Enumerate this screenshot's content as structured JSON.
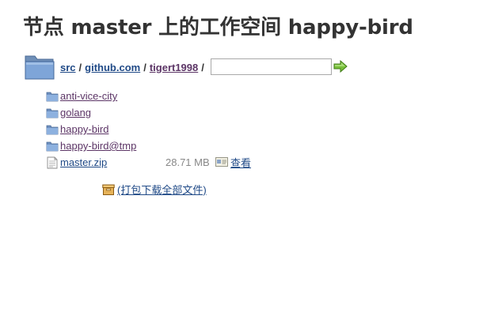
{
  "page_title": "节点 master 上的工作空间 happy-bird",
  "breadcrumb": {
    "items": [
      {
        "label": "src"
      },
      {
        "label": "github.com"
      },
      {
        "label": "tigert1998"
      }
    ],
    "separator": "/"
  },
  "path_input": {
    "value": "",
    "placeholder": ""
  },
  "entries": [
    {
      "name": "anti-vice-city",
      "type": "folder"
    },
    {
      "name": "golang",
      "type": "folder"
    },
    {
      "name": "happy-bird",
      "type": "folder"
    },
    {
      "name": "happy-bird@tmp",
      "type": "folder"
    },
    {
      "name": "master.zip",
      "type": "file",
      "size": "28.71 MB",
      "view_label": "查看"
    }
  ],
  "download_all": {
    "label": "(打包下载全部文件)"
  },
  "colors": {
    "link": "#204a87",
    "visited_link": "#5c3566",
    "folder": "#5b87c5",
    "go_arrow": "#6fb62f"
  },
  "icons": {
    "big_folder": "folder-icon",
    "go": "go-arrow-icon",
    "folder": "folder-icon",
    "file": "text-file-icon",
    "view": "view-file-icon",
    "download": "package-icon"
  }
}
